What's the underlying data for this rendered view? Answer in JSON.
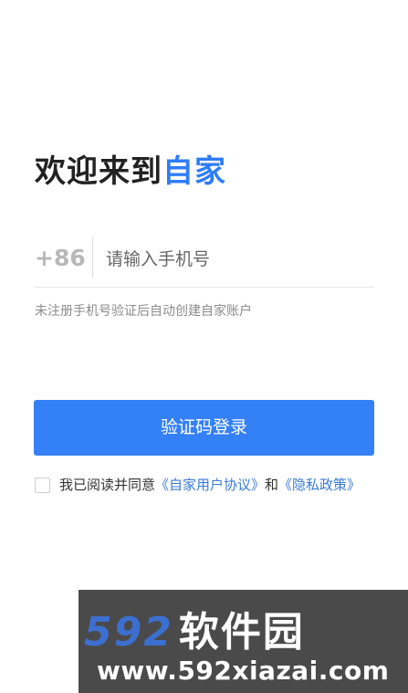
{
  "welcome": {
    "prefix": "欢迎来到",
    "brand": "自家",
    "brand_color": "#2f7df6"
  },
  "phone": {
    "country_code": "+86",
    "placeholder": "请输入手机号",
    "value": ""
  },
  "hint": "未注册手机号验证后自动创建自家账户",
  "login_button": {
    "label": "验证码登录",
    "color": "#3480f6"
  },
  "agreement": {
    "checked": false,
    "prefix": "我已阅读并同意",
    "user_agreement": "《自家用户协议》",
    "connector": "和",
    "privacy_policy": "《隐私政策》"
  },
  "watermark": {
    "logo_digits": "592",
    "logo_text": "软件园",
    "url": "www.592xiazai.com"
  }
}
